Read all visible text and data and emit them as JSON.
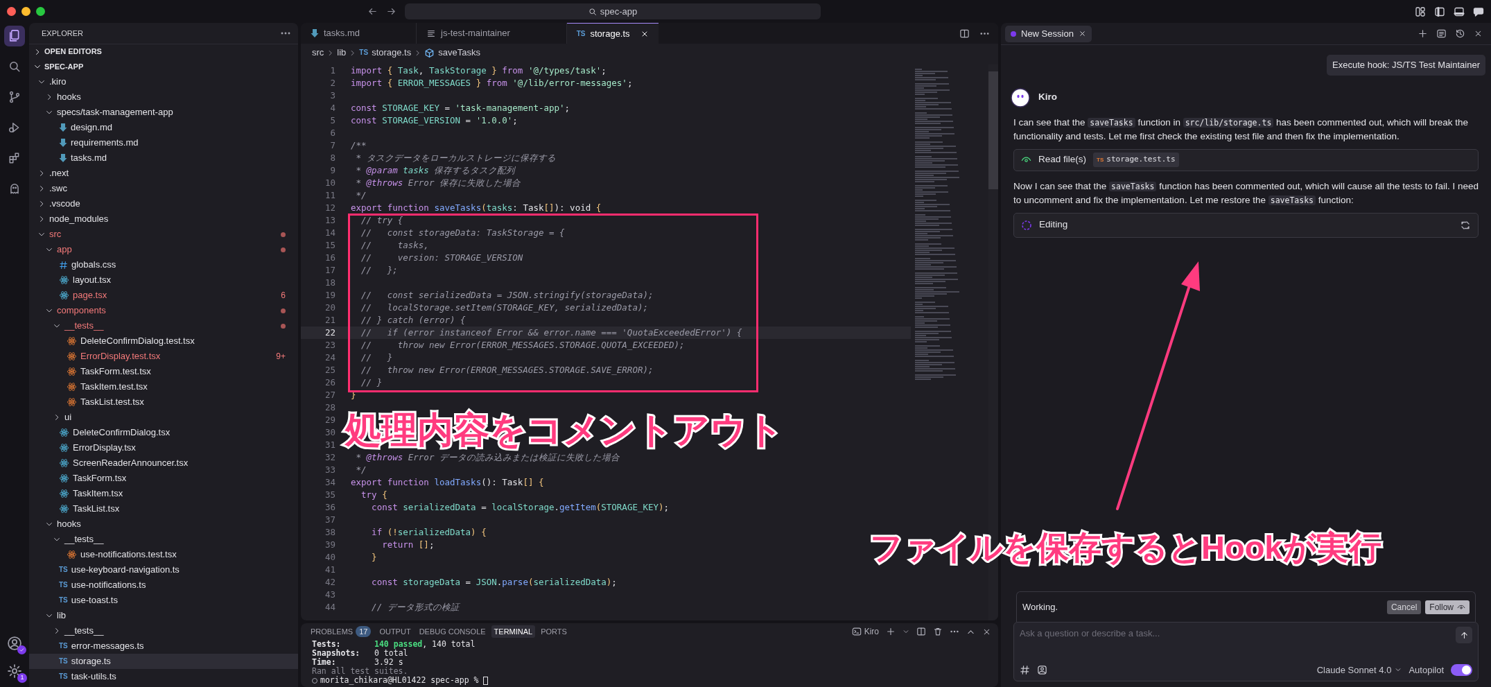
{
  "titlebar": {
    "search": "spec-app"
  },
  "activity_bar": {
    "items": [
      {
        "kind": "files",
        "selected": true
      },
      {
        "kind": "search",
        "selected": false
      },
      {
        "kind": "branch",
        "selected": false
      },
      {
        "kind": "debug",
        "selected": false
      },
      {
        "kind": "extensions",
        "selected": false
      },
      {
        "kind": "ghost",
        "selected": false
      }
    ],
    "settings_badge": "1"
  },
  "sidebar": {
    "title": "EXPLORER",
    "sections": [
      {
        "label": "OPEN EDITORS",
        "expanded": false
      },
      {
        "label": "SPEC-APP",
        "expanded": true
      }
    ],
    "tree": [
      {
        "label": ".kiro",
        "kind": "folder",
        "expanded": true,
        "errors": false,
        "selected": false,
        "children": [
          {
            "label": "hooks",
            "kind": "folder",
            "expanded": false,
            "errors": false,
            "selected": false
          },
          {
            "label": "specs/task-management-app",
            "kind": "folder",
            "expanded": true,
            "errors": false,
            "selected": false,
            "children": [
              {
                "label": "design.md",
                "kind": "markdown",
                "errors": false,
                "selected": false
              },
              {
                "label": "requirements.md",
                "kind": "markdown",
                "errors": false,
                "selected": false
              },
              {
                "label": "tasks.md",
                "kind": "markdown",
                "errors": false,
                "selected": false
              }
            ]
          }
        ]
      },
      {
        "label": ".next",
        "kind": "folder",
        "expanded": false,
        "errors": false,
        "selected": false
      },
      {
        "label": ".swc",
        "kind": "folder",
        "expanded": false,
        "errors": false,
        "selected": false
      },
      {
        "label": ".vscode",
        "kind": "folder",
        "expanded": false,
        "errors": false,
        "selected": false
      },
      {
        "label": "node_modules",
        "kind": "folder",
        "expanded": false,
        "errors": false,
        "selected": false
      },
      {
        "label": "src",
        "kind": "folder",
        "expanded": true,
        "errors": true,
        "selected": false,
        "children": [
          {
            "label": "app",
            "kind": "folder",
            "expanded": true,
            "errors": true,
            "selected": false,
            "children": [
              {
                "label": "globals.css",
                "kind": "css",
                "errors": false,
                "selected": false
              },
              {
                "label": "layout.tsx",
                "kind": "react",
                "errors": false,
                "selected": false
              },
              {
                "label": "page.tsx",
                "kind": "react",
                "errors": true,
                "badge": "6",
                "selected": false
              }
            ]
          },
          {
            "label": "components",
            "kind": "folder",
            "expanded": true,
            "errors": true,
            "selected": false,
            "children": [
              {
                "label": "__tests__",
                "kind": "folder",
                "expanded": true,
                "errors": true,
                "selected": false,
                "children": [
                  {
                    "label": "DeleteConfirmDialog.test.tsx",
                    "kind": "react-test",
                    "errors": false,
                    "selected": false
                  },
                  {
                    "label": "ErrorDisplay.test.tsx",
                    "kind": "react-test",
                    "errors": true,
                    "badge": "9+",
                    "selected": false
                  },
                  {
                    "label": "TaskForm.test.tsx",
                    "kind": "react-test",
                    "errors": false,
                    "selected": false
                  },
                  {
                    "label": "TaskItem.test.tsx",
                    "kind": "react-test",
                    "errors": false,
                    "selected": false
                  },
                  {
                    "label": "TaskList.test.tsx",
                    "kind": "react-test",
                    "errors": false,
                    "selected": false
                  }
                ]
              },
              {
                "label": "ui",
                "kind": "folder",
                "expanded": false,
                "errors": false,
                "selected": false
              },
              {
                "label": "DeleteConfirmDialog.tsx",
                "kind": "react",
                "errors": false,
                "selected": false
              },
              {
                "label": "ErrorDisplay.tsx",
                "kind": "react",
                "errors": false,
                "selected": false
              },
              {
                "label": "ScreenReaderAnnouncer.tsx",
                "kind": "react",
                "errors": false,
                "selected": false
              },
              {
                "label": "TaskForm.tsx",
                "kind": "react",
                "errors": false,
                "selected": false
              },
              {
                "label": "TaskItem.tsx",
                "kind": "react",
                "errors": false,
                "selected": false
              },
              {
                "label": "TaskList.tsx",
                "kind": "react",
                "errors": false,
                "selected": false
              }
            ]
          },
          {
            "label": "hooks",
            "kind": "folder",
            "expanded": true,
            "errors": false,
            "selected": false,
            "children": [
              {
                "label": "__tests__",
                "kind": "folder",
                "expanded": true,
                "errors": false,
                "selected": false,
                "children": [
                  {
                    "label": "use-notifications.test.tsx",
                    "kind": "react-test",
                    "errors": false,
                    "selected": false
                  }
                ]
              },
              {
                "label": "use-keyboard-navigation.ts",
                "kind": "ts",
                "icon_label": "TS",
                "errors": false,
                "selected": false
              },
              {
                "label": "use-notifications.ts",
                "kind": "ts",
                "icon_label": "TS",
                "errors": false,
                "selected": false
              },
              {
                "label": "use-toast.ts",
                "kind": "ts",
                "icon_label": "TS",
                "errors": false,
                "selected": false
              }
            ]
          },
          {
            "label": "lib",
            "kind": "folder",
            "expanded": true,
            "errors": false,
            "selected": false,
            "children": [
              {
                "label": "__tests__",
                "kind": "folder",
                "expanded": false,
                "errors": false,
                "selected": false
              },
              {
                "label": "error-messages.ts",
                "kind": "ts",
                "icon_label": "TS",
                "errors": false,
                "selected": false
              },
              {
                "label": "storage.ts",
                "kind": "ts",
                "icon_label": "TS",
                "errors": false,
                "selected": true
              },
              {
                "label": "task-utils.ts",
                "kind": "ts",
                "icon_label": "TS",
                "errors": false,
                "selected": false
              }
            ]
          }
        ]
      }
    ]
  },
  "editor": {
    "tabs": [
      {
        "label": "tasks.md",
        "kind": "markdown",
        "selected": false
      },
      {
        "label": "js-test-maintainer",
        "kind": "lines",
        "selected": false
      },
      {
        "label": "storage.ts",
        "kind": "ts",
        "icon_label": "TS",
        "selected": true
      }
    ],
    "breadcrumbs": [
      {
        "label": "src",
        "kind": "plain"
      },
      {
        "label": "lib",
        "kind": "plain"
      },
      {
        "label": "storage.ts",
        "kind": "ts",
        "icon_label": "TS"
      },
      {
        "label": "saveTasks",
        "kind": "symbol"
      }
    ],
    "lines": [
      {
        "n": "1",
        "current": false,
        "code": [
          {
            "text": "import ",
            "kind": "kw"
          },
          {
            "text": "{ ",
            "kind": "br"
          },
          {
            "text": "Task",
            "kind": "id"
          },
          {
            "text": ", ",
            "kind": "pl"
          },
          {
            "text": "TaskStorage",
            "kind": "id"
          },
          {
            "text": " } ",
            "kind": "br"
          },
          {
            "text": "from ",
            "kind": "kw"
          },
          {
            "text": "'@/types/task'",
            "kind": "str"
          },
          {
            "text": ";",
            "kind": "pl"
          }
        ]
      },
      {
        "n": "2",
        "current": false,
        "code": [
          {
            "text": "import ",
            "kind": "kw"
          },
          {
            "text": "{ ",
            "kind": "br"
          },
          {
            "text": "ERROR_MESSAGES",
            "kind": "id"
          },
          {
            "text": " } ",
            "kind": "br"
          },
          {
            "text": "from ",
            "kind": "kw"
          },
          {
            "text": "'@/lib/error-messages'",
            "kind": "str"
          },
          {
            "text": ";",
            "kind": "pl"
          }
        ]
      },
      {
        "n": "3",
        "current": false
      },
      {
        "n": "4",
        "current": false,
        "code": [
          {
            "text": "const ",
            "kind": "kw"
          },
          {
            "text": "STORAGE_KEY",
            "kind": "id"
          },
          {
            "text": " = ",
            "kind": "pl"
          },
          {
            "text": "'task-management-app'",
            "kind": "str"
          },
          {
            "text": ";",
            "kind": "pl"
          }
        ]
      },
      {
        "n": "5",
        "current": false,
        "code": [
          {
            "text": "const ",
            "kind": "kw"
          },
          {
            "text": "STORAGE_VERSION",
            "kind": "id"
          },
          {
            "text": " = ",
            "kind": "pl"
          },
          {
            "text": "'1.0.0'",
            "kind": "str"
          },
          {
            "text": ";",
            "kind": "pl"
          }
        ]
      },
      {
        "n": "6",
        "current": false
      },
      {
        "n": "7",
        "current": false,
        "code": [
          {
            "text": "/**",
            "kind": "cm"
          }
        ]
      },
      {
        "n": "8",
        "current": false,
        "code": [
          {
            "text": " * タスクデータをローカルストレージに保存する",
            "kind": "cm"
          }
        ]
      },
      {
        "n": "9",
        "current": false,
        "code": [
          {
            "text": " * ",
            "kind": "cm"
          },
          {
            "text": "@param",
            "kind": "tag"
          },
          {
            "text": " tasks",
            "kind": "doc"
          },
          {
            "text": " 保存するタスク配列",
            "kind": "cm"
          }
        ]
      },
      {
        "n": "10",
        "current": false,
        "code": [
          {
            "text": " * ",
            "kind": "cm"
          },
          {
            "text": "@throws",
            "kind": "tag"
          },
          {
            "text": " Error 保存に失敗した場合",
            "kind": "cm"
          }
        ]
      },
      {
        "n": "11",
        "current": false,
        "code": [
          {
            "text": " */",
            "kind": "cm"
          }
        ]
      },
      {
        "n": "12",
        "current": false,
        "code": [
          {
            "text": "export function ",
            "kind": "kw"
          },
          {
            "text": "saveTasks",
            "kind": "fn"
          },
          {
            "text": "(",
            "kind": "br"
          },
          {
            "text": "tasks",
            "kind": "id"
          },
          {
            "text": ": Task",
            "kind": "pl"
          },
          {
            "text": "[]",
            "kind": "br"
          },
          {
            "text": "): void ",
            "kind": "pl"
          },
          {
            "text": "{",
            "kind": "br"
          }
        ]
      },
      {
        "n": "13",
        "current": false,
        "code": [
          {
            "text": "  // try {",
            "kind": "cm"
          }
        ]
      },
      {
        "n": "14",
        "current": false,
        "code": [
          {
            "text": "  //   const storageData: TaskStorage = {",
            "kind": "cm"
          }
        ]
      },
      {
        "n": "15",
        "current": false,
        "code": [
          {
            "text": "  //     tasks,",
            "kind": "cm"
          }
        ]
      },
      {
        "n": "16",
        "current": false,
        "code": [
          {
            "text": "  //     version: STORAGE_VERSION",
            "kind": "cm"
          }
        ]
      },
      {
        "n": "17",
        "current": false,
        "code": [
          {
            "text": "  //   };",
            "kind": "cm"
          }
        ]
      },
      {
        "n": "18",
        "current": false
      },
      {
        "n": "19",
        "current": false,
        "code": [
          {
            "text": "  //   const serializedData = JSON.stringify(storageData);",
            "kind": "cm"
          }
        ]
      },
      {
        "n": "20",
        "current": false,
        "code": [
          {
            "text": "  //   localStorage.setItem(STORAGE_KEY, serializedData);",
            "kind": "cm"
          }
        ]
      },
      {
        "n": "21",
        "current": false,
        "code": [
          {
            "text": "  // } catch (error) {",
            "kind": "cm"
          }
        ]
      },
      {
        "n": "22",
        "current": true,
        "code": [
          {
            "text": "  //   if (error instanceof Error && error.name === 'QuotaExceededError') {",
            "kind": "cm"
          }
        ]
      },
      {
        "n": "23",
        "current": false,
        "code": [
          {
            "text": "  //     throw new Error(ERROR_MESSAGES.STORAGE.QUOTA_EXCEEDED);",
            "kind": "cm"
          }
        ]
      },
      {
        "n": "24",
        "current": false,
        "code": [
          {
            "text": "  //   }",
            "kind": "cm"
          }
        ]
      },
      {
        "n": "25",
        "current": false,
        "code": [
          {
            "text": "  //   throw new Error(ERROR_MESSAGES.STORAGE.SAVE_ERROR);",
            "kind": "cm"
          }
        ]
      },
      {
        "n": "26",
        "current": false,
        "code": [
          {
            "text": "  // }",
            "kind": "cm"
          }
        ]
      },
      {
        "n": "27",
        "current": false,
        "code": [
          {
            "text": "}",
            "kind": "br"
          }
        ]
      },
      {
        "n": "28",
        "current": false
      },
      {
        "n": "29",
        "current": false
      },
      {
        "n": "30",
        "current": false
      },
      {
        "n": "31",
        "current": false
      },
      {
        "n": "32",
        "current": false,
        "code": [
          {
            "text": " * ",
            "kind": "cm"
          },
          {
            "text": "@throws",
            "kind": "tag"
          },
          {
            "text": " Error データの読み込みまたは検証に失敗した場合",
            "kind": "cm"
          }
        ]
      },
      {
        "n": "33",
        "current": false,
        "code": [
          {
            "text": " */",
            "kind": "cm"
          }
        ]
      },
      {
        "n": "34",
        "current": false,
        "code": [
          {
            "text": "export function ",
            "kind": "kw"
          },
          {
            "text": "loadTasks",
            "kind": "fn"
          },
          {
            "text": "(): Task",
            "kind": "pl"
          },
          {
            "text": "[] ",
            "kind": "br"
          },
          {
            "text": "{",
            "kind": "br"
          }
        ]
      },
      {
        "n": "35",
        "current": false,
        "code": [
          {
            "text": "  try ",
            "kind": "kw"
          },
          {
            "text": "{",
            "kind": "br"
          }
        ]
      },
      {
        "n": "36",
        "current": false,
        "code": [
          {
            "text": "    const ",
            "kind": "kw"
          },
          {
            "text": "serializedData",
            "kind": "id"
          },
          {
            "text": " = ",
            "kind": "pl"
          },
          {
            "text": "localStorage",
            "kind": "id"
          },
          {
            "text": ".",
            "kind": "pl"
          },
          {
            "text": "getItem",
            "kind": "fn"
          },
          {
            "text": "(",
            "kind": "br"
          },
          {
            "text": "STORAGE_KEY",
            "kind": "id"
          },
          {
            "text": ")",
            "kind": "br"
          },
          {
            "text": ";",
            "kind": "pl"
          }
        ]
      },
      {
        "n": "37",
        "current": false
      },
      {
        "n": "38",
        "current": false,
        "code": [
          {
            "text": "    if ",
            "kind": "kw"
          },
          {
            "text": "(!",
            "kind": "br"
          },
          {
            "text": "serializedData",
            "kind": "id"
          },
          {
            "text": ") {",
            "kind": "br"
          }
        ]
      },
      {
        "n": "39",
        "current": false,
        "code": [
          {
            "text": "      return ",
            "kind": "kw"
          },
          {
            "text": "[]",
            "kind": "br"
          },
          {
            "text": ";",
            "kind": "pl"
          }
        ]
      },
      {
        "n": "40",
        "current": false,
        "code": [
          {
            "text": "    }",
            "kind": "br"
          }
        ]
      },
      {
        "n": "41",
        "current": false
      },
      {
        "n": "42",
        "current": false,
        "code": [
          {
            "text": "    const ",
            "kind": "kw"
          },
          {
            "text": "storageData",
            "kind": "id"
          },
          {
            "text": " = ",
            "kind": "pl"
          },
          {
            "text": "JSON",
            "kind": "id"
          },
          {
            "text": ".",
            "kind": "pl"
          },
          {
            "text": "parse",
            "kind": "fn"
          },
          {
            "text": "(",
            "kind": "br"
          },
          {
            "text": "serializedData",
            "kind": "id"
          },
          {
            "text": ")",
            "kind": "br"
          },
          {
            "text": ";",
            "kind": "pl"
          }
        ]
      },
      {
        "n": "43",
        "current": false
      },
      {
        "n": "44",
        "current": false,
        "code": [
          {
            "text": "    // データ形式の検証",
            "kind": "cm"
          }
        ]
      }
    ]
  },
  "panel": {
    "tabs": [
      {
        "label": "PROBLEMS",
        "badge": "17",
        "selected": false
      },
      {
        "label": "OUTPUT",
        "selected": false
      },
      {
        "label": "DEBUG CONSOLE",
        "selected": false
      },
      {
        "label": "TERMINAL",
        "selected": true
      },
      {
        "label": "PORTS",
        "selected": false
      }
    ],
    "terminal_name": "Kiro",
    "lines": [
      [
        {
          "text": "Tests:       ",
          "kind": "bold"
        },
        {
          "text": "140 passed",
          "kind": "pass"
        },
        {
          "text": ", 140 total",
          "kind": "pl"
        }
      ],
      [
        {
          "text": "Snapshots:   ",
          "kind": "bold"
        },
        {
          "text": "0 total",
          "kind": "pl"
        }
      ],
      [
        {
          "text": "Time:        ",
          "kind": "bold"
        },
        {
          "text": "3.92 s",
          "kind": "pl"
        }
      ],
      [
        {
          "text": "Ran all test suites.",
          "kind": "dim"
        }
      ],
      [
        {
          "text": "morita_chikara@HL01422 spec-app % ",
          "kind": "pl"
        }
      ]
    ]
  },
  "chat": {
    "tab": {
      "label": "New Session"
    },
    "messages": [
      {
        "kind": "user",
        "text": "Execute hook: JS/TS Test Maintainer"
      },
      {
        "kind": "author",
        "name": "Kiro"
      },
      {
        "kind": "paragraph",
        "segments": [
          {
            "text": "I can see that the ",
            "code": false
          },
          {
            "text": "saveTasks",
            "code": true
          },
          {
            "text": " function in ",
            "code": false
          },
          {
            "text": "src/lib/storage.ts",
            "code": true
          },
          {
            "text": " has been commented out, which will break the functionality and tests. Let me first check the existing test file and then fix the implementation.",
            "code": false
          }
        ]
      },
      {
        "kind": "tool",
        "label": "Read file(s)",
        "file_icon_label": "TS",
        "file": "storage.test.ts"
      },
      {
        "kind": "paragraph",
        "segments": [
          {
            "text": "Now I can see that the ",
            "code": false
          },
          {
            "text": "saveTasks",
            "code": true
          },
          {
            "text": " function has been commented out, which will cause all the tests to fail. I need to uncomment and fix the implementation. Let me restore the ",
            "code": false
          },
          {
            "text": "saveTasks",
            "code": true
          },
          {
            "text": " function:",
            "code": false
          }
        ]
      },
      {
        "kind": "progress",
        "label": "Editing"
      }
    ],
    "status": {
      "text": "Working.",
      "buttons": [
        {
          "label": "Cancel",
          "kind": "cancel"
        },
        {
          "label": "Follow",
          "kind": "follow"
        }
      ]
    },
    "input": {
      "placeholder": "Ask a question or describe a task..."
    },
    "model": "Claude Sonnet 4.0",
    "autopilot": {
      "label": "Autopilot",
      "on": true
    }
  },
  "annotations": [
    {
      "kind": "caption",
      "text": "処理内容をコメントアウト"
    },
    {
      "kind": "caption",
      "text": "ファイルを保存するとHookが実行"
    },
    {
      "kind": "frame"
    },
    {
      "kind": "arrow"
    }
  ]
}
